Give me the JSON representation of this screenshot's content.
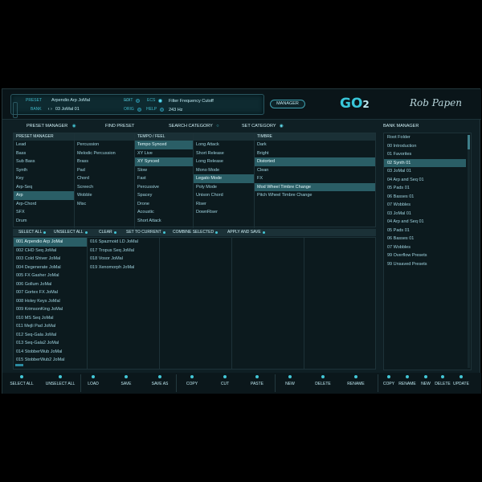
{
  "header": {
    "preset_label": "PRESET",
    "preset_value": "Arpendio Arp JoMal",
    "bank_label": "BANK",
    "bank_value": "03 JoMal 01",
    "edit_label": "EDIT",
    "orig_label": "ORIG",
    "ecs_label": "ECS",
    "help_label": "HELP",
    "info_line1": "Filter Frequency Cutoff",
    "info_line2": "243 Hz",
    "manager_button": "MANAGER",
    "logo_main": "GO",
    "logo_num": "2",
    "signature": "Rob Papen"
  },
  "sections": {
    "preset_manager": "PRESET MANAGER",
    "find_preset": "FIND PRESET",
    "search_category": "SEARCH CATEGORY",
    "set_category": "SET CATEGORY",
    "bank_manager": "BANK MANAGER"
  },
  "filters": {
    "col1": {
      "title": "PRESET MANAGER",
      "items": [
        "Lead",
        "Bass",
        "Sub Bass",
        "Synth",
        "Key",
        "Arp-Seq",
        "Arp",
        "Arp-Chord",
        "SFX",
        "Drum"
      ],
      "selected": 6
    },
    "col2": {
      "title": "",
      "items": [
        "Percussion",
        "Melodic Percussion",
        "Brass",
        "Pad",
        "Chord",
        "Screech",
        "Wobble",
        "Misc"
      ]
    },
    "col3": {
      "title": "TEMPO / FEEL",
      "items": [
        "Tempo Synced",
        "XY Live",
        "XY Synced",
        "Slow",
        "Fast",
        "Percussive",
        "Spacey",
        "Drone",
        "Acoustic",
        "Short Attack"
      ],
      "selected": [
        0,
        2
      ]
    },
    "col4": {
      "title": "",
      "items": [
        "Long Attack",
        "Short Release",
        "Long Release",
        "Mono Mode",
        "Legato Mode",
        "Poly Mode",
        "Unison Chord",
        "Riser",
        "DownRiser"
      ],
      "selected": [
        4
      ]
    },
    "col5": {
      "title": "TIMBRE",
      "items": [
        "Dark",
        "Bright",
        "Distorted",
        "Clean",
        "FX",
        "Mod Wheel Timbre Change",
        "Pitch Wheel Timbre Change"
      ],
      "selected": [
        2,
        5
      ]
    }
  },
  "toolbar": [
    "SELECT ALL",
    "UNSELECT ALL",
    "CLEAR",
    "SET TO CURRENT",
    "COMBINE SELECTED",
    "APPLY AND SAVE"
  ],
  "presets": {
    "col1": [
      "001 Arpendio Arp JoMal",
      "002 CHD Seq JoMal",
      "003 Cold Shiver JoMal",
      "004 Degenerate JoMal",
      "005 FX Gasher JoMal",
      "006 Gollum JoMal",
      "007 Gortex FX JoMal",
      "008 Holey Keys JoMal",
      "009 KrimsonKing JoMal",
      "010 MS Seq JoMal",
      "011 Mejli Pad JoMal",
      "012 Seq-Gala JoMal",
      "013 Seq-Gala2 JoMal",
      "014 StobberWub JoMal",
      "015 StobberWub2 JoMal"
    ],
    "col2": [
      "016 Spazmoid LD JoMal",
      "017 Tropus Seq JoMal",
      "018 Vosor JoMal",
      "019 Xenomorph JoMal"
    ],
    "selected": 0
  },
  "bank": {
    "items": [
      "Root Folder",
      "00 Introduction",
      "01 Favorites",
      "02 Synth 01",
      "03 JoMal 01",
      "04 Arp and Seq 01",
      "05 Pads 01",
      "06 Basses 01",
      "07 Wobbles",
      "03 JoMal 01",
      "04 Arp and Seq 01",
      "05 Pads 01",
      "06 Basses 01",
      "07 Wobbles",
      "99 Overflow Presets",
      "99 Unsaved Presets"
    ],
    "selected": 3
  },
  "bottom_buttons": {
    "select_all": "SELECT ALL",
    "unselect_all": "UNSELECT ALL",
    "load": "LOAD",
    "save": "SAVE",
    "save_as": "SAVE AS",
    "copy": "COPY",
    "cut": "CUT",
    "paste": "PASTE",
    "new": "NEW",
    "delete": "DELETE",
    "rename": "RENAME",
    "bank_copy": "COPY",
    "bank_rename": "RENAME",
    "bank_new": "NEW",
    "bank_delete": "DELETE",
    "bank_update": "UPDATE"
  },
  "colors": {
    "accent": "#43c6d6",
    "selection": "#2a5e66",
    "panel": "#0f1f24"
  }
}
